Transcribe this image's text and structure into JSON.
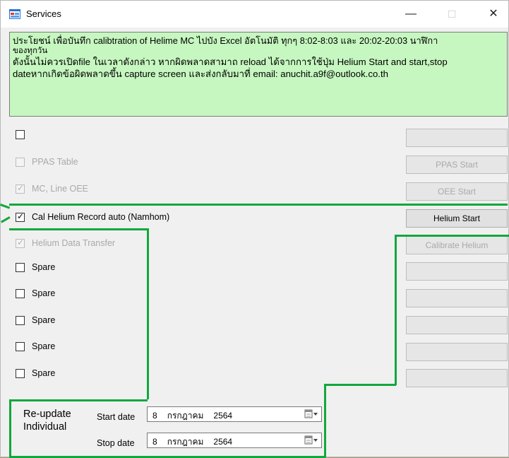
{
  "window": {
    "title": "Services",
    "controls": {
      "minimize": "—",
      "maximize": "☐",
      "close": "✕"
    }
  },
  "info": {
    "line1_thai_a": "ประโยชน์ เพื่อบันทึก calibtration of Helime MC ไปบัง  Excel อัตโนมัติ ทุกๆ 8:02-8:03 และ 20:02-20:03 นาฬิกา",
    "line2": "ของทุกวัน",
    "line3": "ดังนั้นไม่ควรเปิดfile ในเวลาดังกล่าว   หากผิดพลาดสามาถ reload ได้จากการใช้ปุ่ม Helium Start and start,stop",
    "line4": "dateหากเกิดข้อผิดพลาดขึ้น capture screen และส่งกลับมาที่ email: anuchit.a9f@outlook.co.th"
  },
  "rows": [
    {
      "label": "",
      "checked": false,
      "enabled": true,
      "button": "",
      "button_enabled": false
    },
    {
      "label": "PPAS Table",
      "checked": false,
      "enabled": false,
      "button": "PPAS Start",
      "button_enabled": false
    },
    {
      "label": "MC, Line OEE",
      "checked": true,
      "enabled": false,
      "button": "OEE Start",
      "button_enabled": false
    },
    {
      "label": "Cal Helium Record auto (Namhom)",
      "checked": true,
      "enabled": true,
      "button": "Helium Start",
      "button_enabled": true
    },
    {
      "label": "Helium Data Transfer",
      "checked": true,
      "enabled": false,
      "button": "Calibrate Helium",
      "button_enabled": false
    },
    {
      "label": "Spare",
      "checked": false,
      "enabled": true,
      "button": "",
      "button_enabled": false
    },
    {
      "label": "Spare",
      "checked": false,
      "enabled": true,
      "button": "",
      "button_enabled": false
    },
    {
      "label": "Spare",
      "checked": false,
      "enabled": true,
      "button": "",
      "button_enabled": false
    },
    {
      "label": "Spare",
      "checked": false,
      "enabled": true,
      "button": "",
      "button_enabled": false
    },
    {
      "label": "Spare",
      "checked": false,
      "enabled": true,
      "button": "",
      "button_enabled": false
    }
  ],
  "reupdate": {
    "label_line1": "Re-update",
    "label_line2": "Individual",
    "start_label": "Start date",
    "stop_label": "Stop date",
    "start_date": {
      "day": "8",
      "month": "กรกฎาคม",
      "year": "2564"
    },
    "stop_date": {
      "day": "8",
      "month": "กรกฎาคม",
      "year": "2564"
    }
  },
  "colors": {
    "info_bg": "#c6f7c0",
    "annotation": "#11a83c",
    "disabled_text": "#a9a9a9"
  },
  "check_glyph": "✓"
}
